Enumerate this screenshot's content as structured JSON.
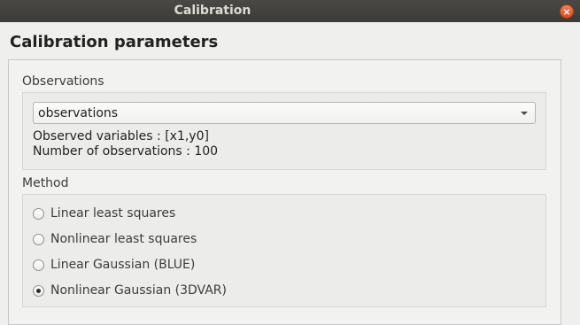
{
  "window": {
    "title": "Calibration"
  },
  "heading": "Calibration parameters",
  "observations": {
    "group_label": "Observations",
    "selected": "observations",
    "observed_variables": "Observed variables : [x1,y0]",
    "number_of_observations": "Number of observations : 100"
  },
  "method": {
    "group_label": "Method",
    "options": [
      {
        "label": "Linear least squares",
        "checked": false
      },
      {
        "label": "Nonlinear least squares",
        "checked": false
      },
      {
        "label": "Linear Gaussian (BLUE)",
        "checked": false
      },
      {
        "label": "Nonlinear Gaussian (3DVAR)",
        "checked": true
      }
    ]
  }
}
